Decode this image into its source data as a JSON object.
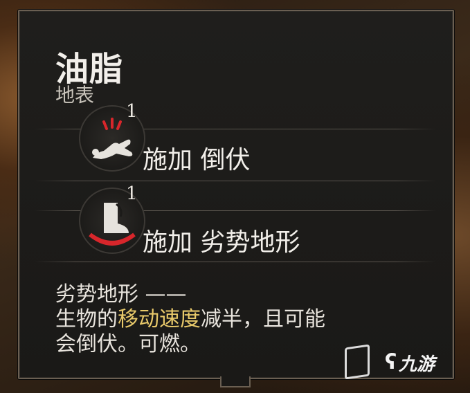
{
  "tooltip": {
    "title": "油脂",
    "subtitle": "地表",
    "effects": [
      {
        "icon": "prone-figure-icon",
        "stack": "1",
        "label": "施加 倒伏"
      },
      {
        "icon": "difficult-terrain-boot-icon",
        "stack": "1",
        "label": "施加 劣势地形"
      }
    ],
    "description": {
      "line1": "劣势地形 ——",
      "line2_pre": "生物的",
      "line2_highlight": "移动速度",
      "line2_post": "减半，且可能",
      "line3": "会倒伏。可燃。"
    }
  },
  "watermark": {
    "text": "九游",
    "icon": "jiuyou-logo-icon"
  },
  "colors": {
    "highlight": "#e8c96a",
    "accent_red": "#d8262b",
    "border": "#6a5f52"
  }
}
